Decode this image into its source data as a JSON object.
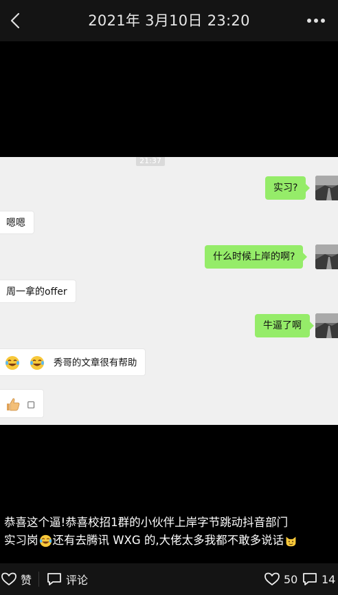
{
  "header": {
    "title": "2021年 3月10日 23:20"
  },
  "chat": {
    "timestamp": "21:37",
    "messages": [
      {
        "side": "out",
        "text": "实习?"
      },
      {
        "side": "in",
        "text": "嗯嗯"
      },
      {
        "side": "out",
        "text": "什么时候上岸的啊?"
      },
      {
        "side": "in",
        "text": "周一拿的offer"
      },
      {
        "side": "out",
        "text": "牛逼了啊"
      },
      {
        "side": "in",
        "text": "秀哥的文章很有帮助"
      },
      {
        "side": "in",
        "text": "□"
      }
    ]
  },
  "caption": {
    "line1": "恭喜这个逼!恭喜校招1群的小伙伴上岸字节跳动抖音部门",
    "line2a": "实习岗",
    "line2b": "还有去腾讯 WXG 的,大佬太多我都不敢多说话"
  },
  "actions": {
    "like_label": "赞",
    "comment_label": "评论",
    "like_count": "50",
    "comment_count": "14"
  },
  "icons": {
    "back": "chevron-left-icon",
    "more": "more-dots-icon",
    "heart": "heart-icon",
    "comment": "comment-icon",
    "laugh": "laugh-cry-emoji",
    "thumbs": "thumbs-up-emoji",
    "cat": "cat-emoji"
  }
}
